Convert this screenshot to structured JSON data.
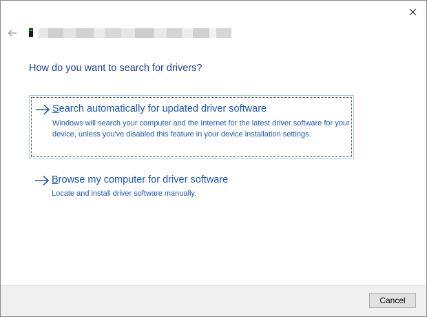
{
  "dialog": {
    "heading": "How do you want to search for drivers?",
    "close_icon": "close-icon",
    "back_icon": "back-arrow-icon",
    "device_icon": "device-icon"
  },
  "options": [
    {
      "title_first": "S",
      "title_rest": "earch automatically for updated driver software",
      "description": "Windows will search your computer and the Internet for the latest driver software for your device, unless you've disabled this feature in your device installation settings.",
      "icon": "arrow-right-icon",
      "focused": true
    },
    {
      "title_first": "B",
      "title_rest": "rowse my computer for driver software",
      "description": "Locate and install driver software manually.",
      "icon": "arrow-right-icon",
      "focused": false
    }
  ],
  "footer": {
    "cancel_label": "Cancel"
  },
  "colors": {
    "heading": "#1c3f94",
    "link": "#1a55b0",
    "focus_border": "#9ec8e8",
    "footer_bg": "#f0f0f0"
  }
}
